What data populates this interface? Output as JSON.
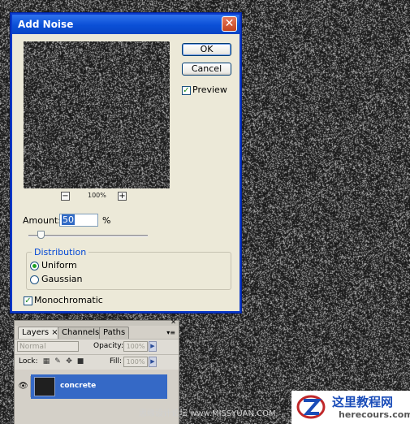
{
  "dialog": {
    "title": "Add Noise",
    "ok_label": "OK",
    "cancel_label": "Cancel",
    "preview_label": "Preview",
    "preview_checked": true,
    "zoom_level": "100%",
    "amount_label": "Amount:",
    "amount_value": "50",
    "amount_unit": "%",
    "distribution_title": "Distribution",
    "uniform_label": "Uniform",
    "gaussian_label": "Gaussian",
    "selected_distribution": "Uniform",
    "monochromatic_label": "Monochromatic",
    "monochromatic_checked": true
  },
  "layers_panel": {
    "tabs": [
      "Layers",
      "Channels",
      "Paths"
    ],
    "blend_mode": "Normal",
    "opacity_label": "Opacity:",
    "opacity_value": "100%",
    "lock_label": "Lock:",
    "fill_label": "Fill:",
    "fill_value": "100%",
    "layer_name": "concrete"
  },
  "watermark": {
    "caption": "思缘设计论坛 www.MISSYUAN.COM",
    "logo_title": "这里教程网",
    "logo_url": "herecours.com"
  },
  "colors": {
    "accent": "#0a4fd6",
    "selection": "#3569c6",
    "background": "#1e1e1e"
  }
}
